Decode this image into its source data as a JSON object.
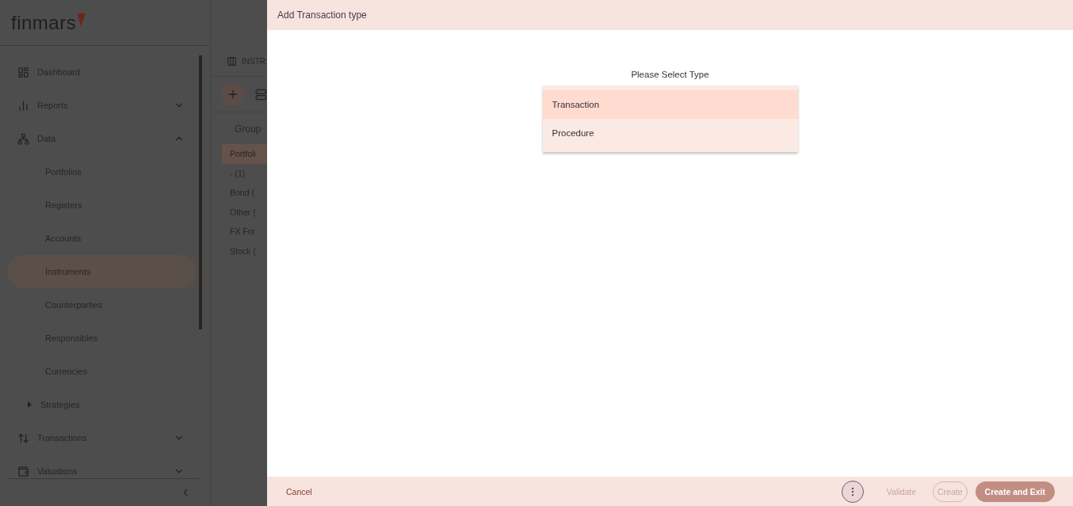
{
  "logo": {
    "text": "finmars"
  },
  "sidebar": {
    "items": [
      {
        "label": "Dashboard",
        "kind": "dashboard",
        "selected": false
      },
      {
        "label": "Reports",
        "kind": "chart",
        "selected": false,
        "expanded": false
      },
      {
        "label": "Data",
        "kind": "tree",
        "selected": false,
        "expanded": true,
        "children": [
          {
            "label": "Portfolios",
            "selected": false
          },
          {
            "label": "Registers",
            "selected": false
          },
          {
            "label": "Accounts",
            "selected": false
          },
          {
            "label": "Instruments",
            "selected": true
          },
          {
            "label": "Counterparties",
            "selected": false
          },
          {
            "label": "Responsibles",
            "selected": false
          },
          {
            "label": "Currencies",
            "selected": false
          },
          {
            "label": "Strategies",
            "selected": false,
            "expanded": false
          }
        ]
      },
      {
        "label": "Transactions",
        "kind": "arrows",
        "selected": false,
        "expanded": false
      },
      {
        "label": "Valuations",
        "kind": "wallet",
        "selected": false,
        "expanded": false
      }
    ]
  },
  "content": {
    "title": "INSTR",
    "group_header": "Group",
    "groups": [
      {
        "label": "Portfoli",
        "selected": true
      },
      {
        "label": "- (1)",
        "selected": false
      },
      {
        "label": "Bond (",
        "selected": false
      },
      {
        "label": "Other (",
        "selected": false
      },
      {
        "label": "FX For",
        "selected": false
      },
      {
        "label": "Stock (",
        "selected": false
      }
    ]
  },
  "dialog": {
    "title": "Add Transaction type",
    "prompt": "Please Select Type",
    "options": [
      {
        "label": "Transaction",
        "selected": true
      },
      {
        "label": "Procedure",
        "selected": false
      }
    ],
    "footer": {
      "cancel": "Cancel",
      "validate": {
        "label": "Validate",
        "disabled": true
      },
      "create": {
        "label": "Create",
        "disabled": true
      },
      "create_exit": {
        "label": "Create and Exit",
        "disabled": false
      }
    }
  }
}
